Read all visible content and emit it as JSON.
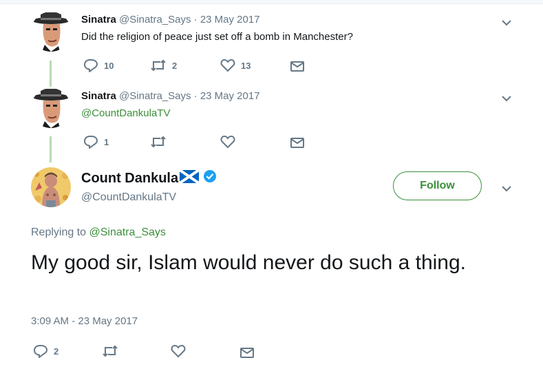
{
  "tweets": [
    {
      "name": "Sinatra",
      "handle": "@Sinatra_Says",
      "separator": "·",
      "date": "23 May 2017",
      "text": "Did the religion of peace just set off a bomb in Manchester?",
      "replies": "10",
      "retweets": "2",
      "likes": "13"
    },
    {
      "name": "Sinatra",
      "handle": "@Sinatra_Says",
      "separator": "·",
      "date": "23 May 2017",
      "text": "@CountDankulaTV",
      "replies": "1",
      "retweets": "",
      "likes": ""
    }
  ],
  "main": {
    "name": "Count Dankula",
    "handle": "@CountDankulaTV",
    "follow_label": "Follow",
    "replying_prefix": "Replying to",
    "replying_to": "@Sinatra_Says",
    "text": "My good sir, Islam would never do such a thing.",
    "timestamp": "3:09 AM - 23 May 2017",
    "replies": "2",
    "retweets": "",
    "likes": ""
  },
  "icons": {
    "reply": "reply-icon",
    "retweet": "retweet-icon",
    "like": "heart-icon",
    "dm": "envelope-icon",
    "more": "chevron-down-icon",
    "verified": "verified-badge-icon",
    "flag": "scotland-flag-icon"
  },
  "colors": {
    "accent": "#3a8f3a",
    "thread_line": "#b6dbb0",
    "muted": "#657786",
    "verified": "#1da1f2",
    "flag_blue": "#0065bd"
  }
}
